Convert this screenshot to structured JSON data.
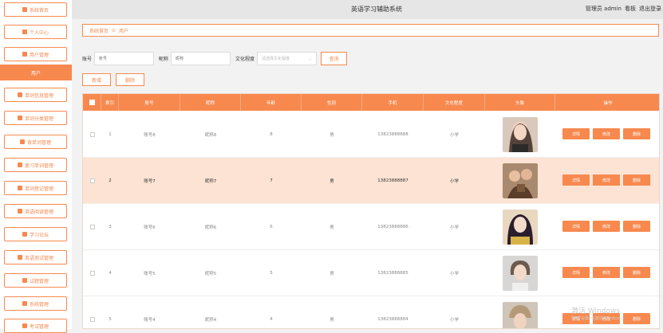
{
  "header": {
    "title": "英语学习辅助系统",
    "user_prefix": "管理员 admin",
    "kanban": "看板",
    "logout": "退出登录"
  },
  "sidebar": {
    "items": [
      {
        "label": "系统首页",
        "icon": "home-icon"
      },
      {
        "label": "个人中心",
        "icon": "user-icon"
      },
      {
        "label": "用户管理",
        "icon": "users-icon"
      },
      {
        "label": "用户",
        "icon": "",
        "active": true
      },
      {
        "label": "单词信息管理",
        "icon": "grid-icon"
      },
      {
        "label": "单词分类管理",
        "icon": "folder-icon"
      },
      {
        "label": "背单词管理",
        "icon": "user-icon"
      },
      {
        "label": "复习单词管理",
        "icon": "book-icon"
      },
      {
        "label": "单词登记管理",
        "icon": "grid-icon"
      },
      {
        "label": "英语阅读管理",
        "icon": "grid-icon"
      },
      {
        "label": "学习论坛",
        "icon": "chat-icon"
      },
      {
        "label": "英语测试管理",
        "icon": "grid-icon"
      },
      {
        "label": "试题管理",
        "icon": "edit-icon"
      },
      {
        "label": "系统管理",
        "icon": "gear-icon"
      },
      {
        "label": "考试管理",
        "icon": "grid-icon"
      }
    ]
  },
  "breadcrumb": {
    "home": "系统首页",
    "sep": "⊙",
    "current": "用户"
  },
  "search": {
    "account_label": "账号",
    "account_placeholder": "账号",
    "nickname_label": "昵称",
    "nickname_placeholder": "昵称",
    "edu_label": "文化程度",
    "edu_placeholder": "请选择文化程度",
    "search_button": "查询"
  },
  "actions": {
    "add": "新增",
    "delete": "删除"
  },
  "table": {
    "headers": [
      "索引",
      "账号",
      "昵称",
      "年龄",
      "性别",
      "手机",
      "文化程度",
      "头像",
      "操作"
    ],
    "row_buttons": {
      "detail": "详情",
      "edit": "修改",
      "delete": "删除"
    },
    "rows": [
      {
        "index": "1",
        "account": "账号8",
        "nickname": "昵称8",
        "age": "8",
        "gender": "男",
        "phone": "13823888888",
        "edu": "小学"
      },
      {
        "index": "2",
        "account": "账号7",
        "nickname": "昵称7",
        "age": "7",
        "gender": "男",
        "phone": "13823888887",
        "edu": "小学"
      },
      {
        "index": "3",
        "account": "账号6",
        "nickname": "昵称6",
        "age": "6",
        "gender": "男",
        "phone": "13823888886",
        "edu": "小学"
      },
      {
        "index": "4",
        "account": "账号5",
        "nickname": "昵称5",
        "age": "5",
        "gender": "男",
        "phone": "13823888885",
        "edu": "小学"
      },
      {
        "index": "5",
        "account": "账号4",
        "nickname": "昵称4",
        "age": "4",
        "gender": "男",
        "phone": "13823888884",
        "edu": "小学"
      }
    ]
  },
  "watermark": {
    "line1": "激活 Windows",
    "line2": "转到\"设置\"以激活 Windows。"
  },
  "colors": {
    "accent": "#f7894f",
    "highlight_row": "#fde3d3"
  }
}
